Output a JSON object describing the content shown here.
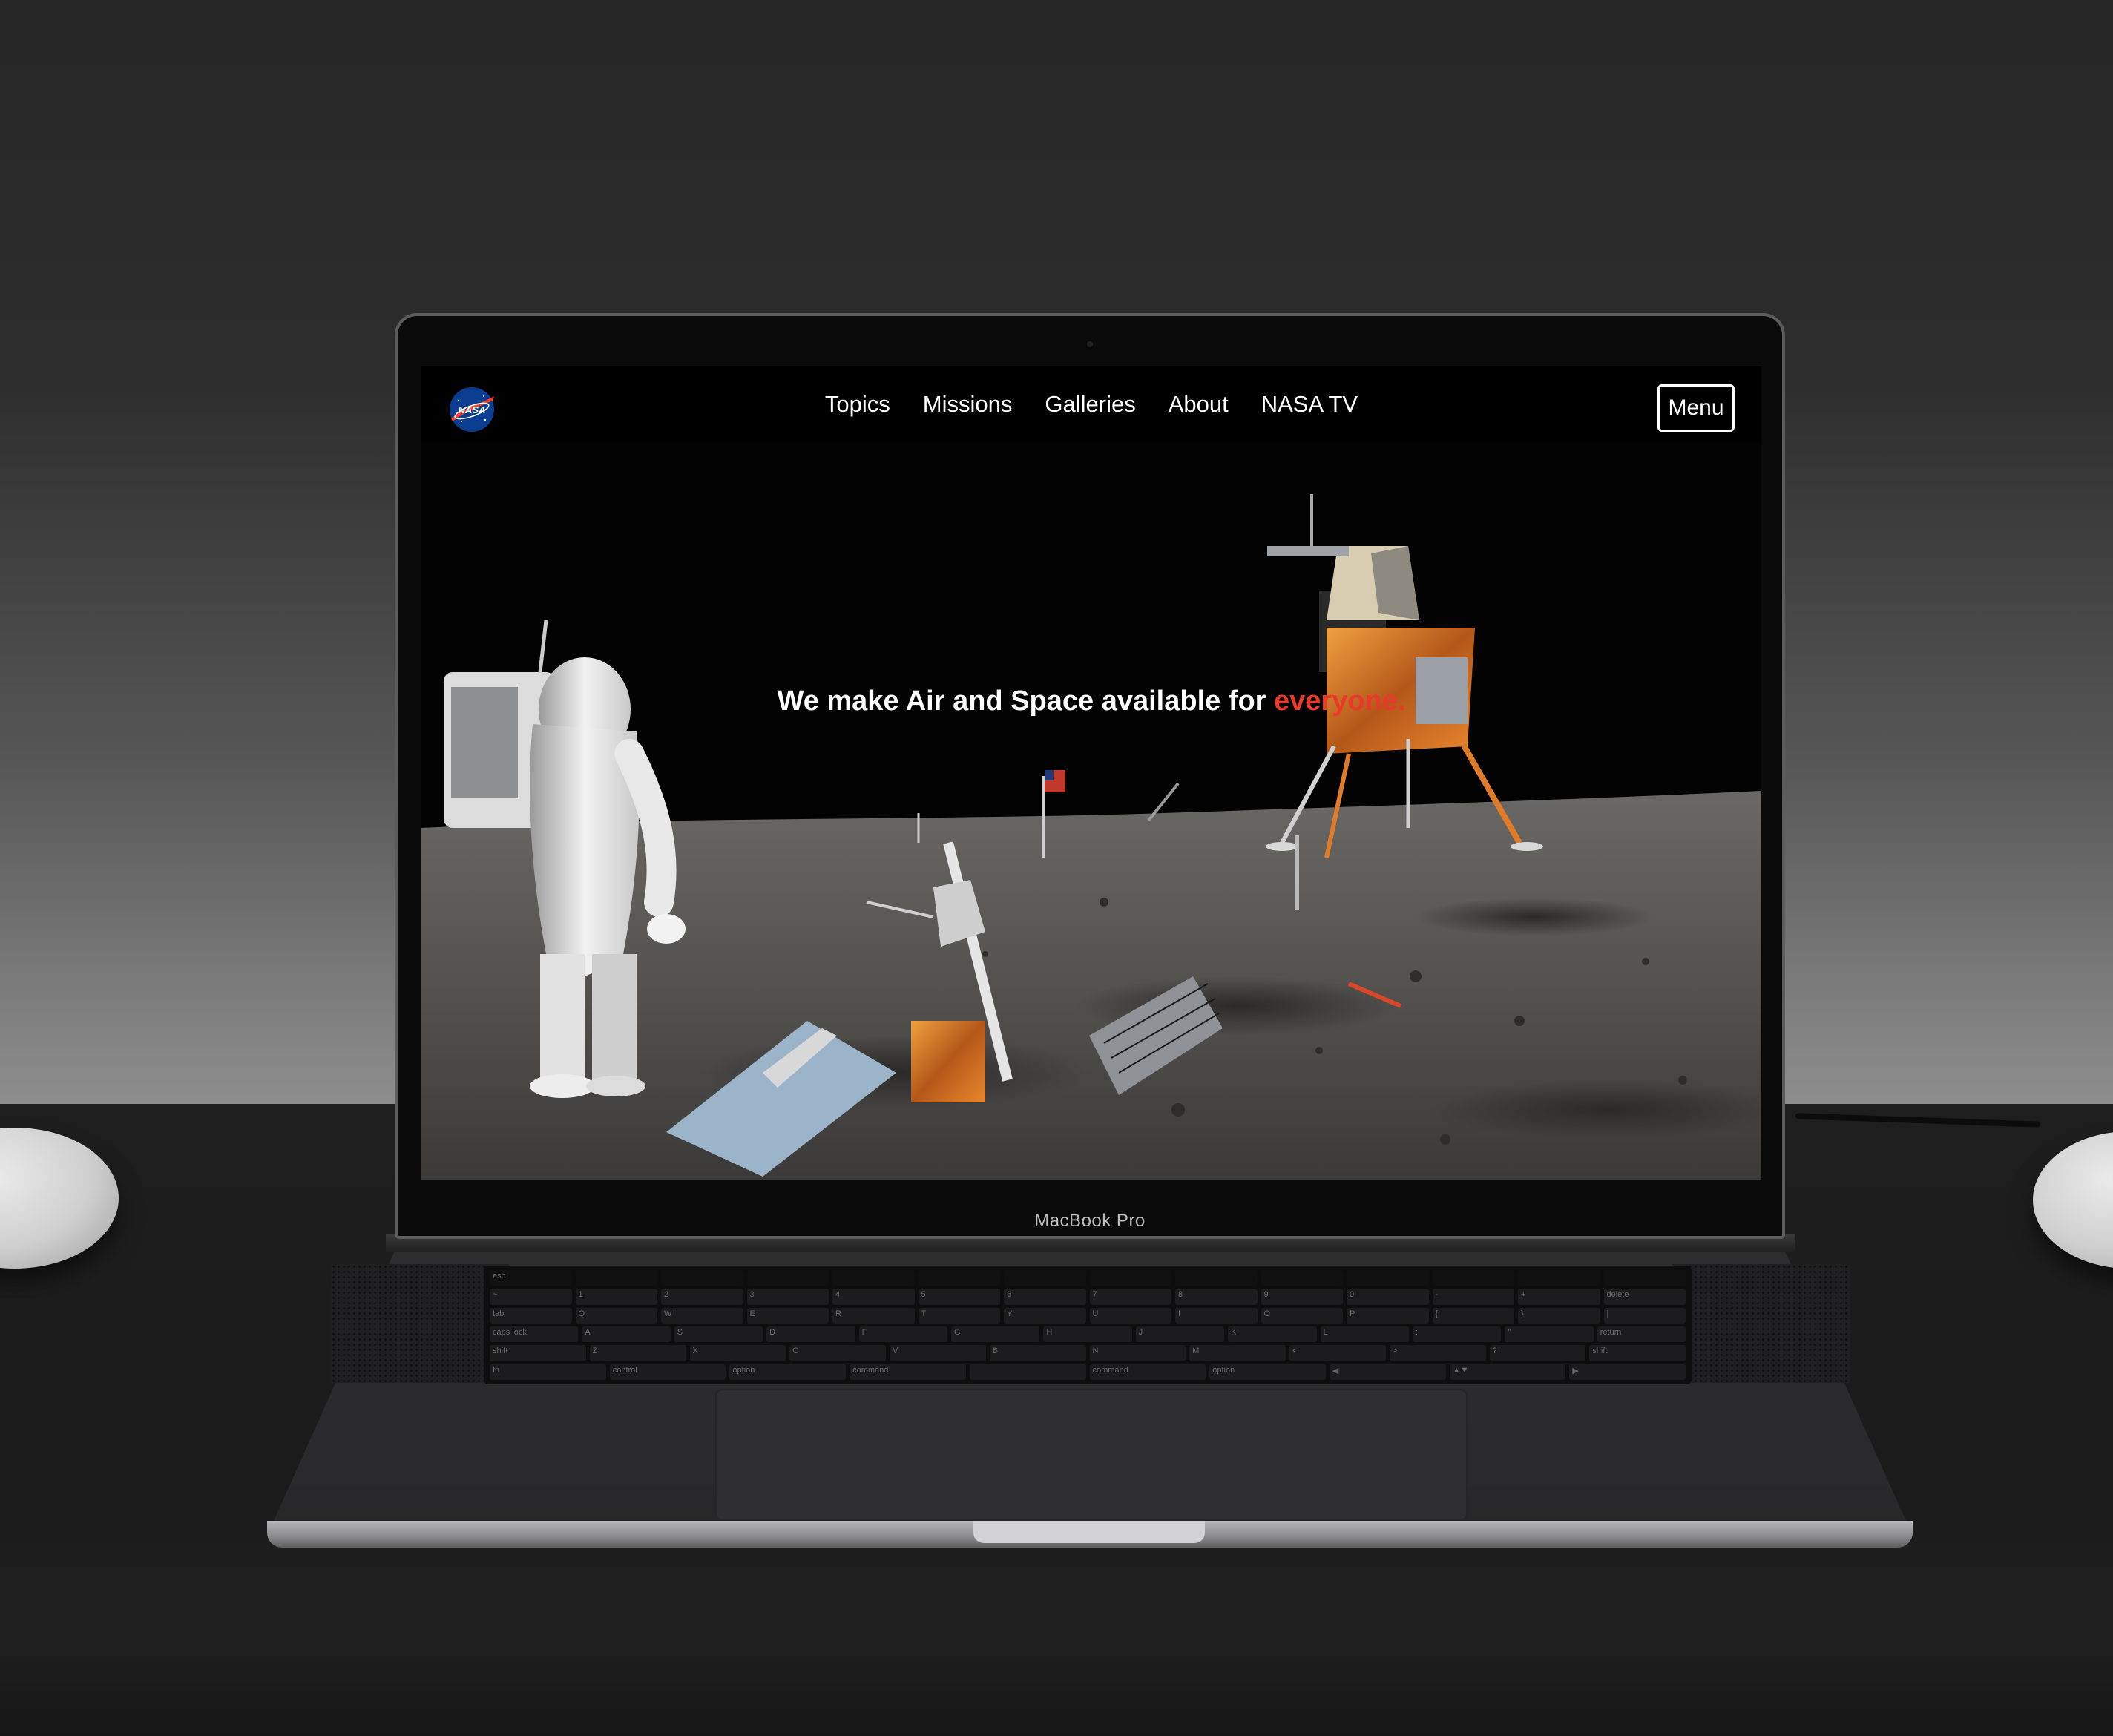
{
  "device": {
    "model_label": "MacBook Pro"
  },
  "site": {
    "logo_text": "NASA",
    "nav": {
      "items": [
        {
          "label": "Topics"
        },
        {
          "label": "Missions"
        },
        {
          "label": "Galleries"
        },
        {
          "label": "About"
        },
        {
          "label": "NASA TV"
        }
      ],
      "menu_label": "Menu"
    },
    "hero": {
      "headline_prefix": "We make Air and Space available for ",
      "headline_accent": "everyone",
      "headline_suffix": ".",
      "accent_color": "#e8392a"
    }
  },
  "keyboard": {
    "rows": [
      [
        "esc",
        "",
        "",
        "",
        "",
        "",
        "",
        "",
        "",
        "",
        "",
        "",
        "",
        ""
      ],
      [
        "~",
        "1",
        "2",
        "3",
        "4",
        "5",
        "6",
        "7",
        "8",
        "9",
        "0",
        "-",
        "+",
        "delete"
      ],
      [
        "tab",
        "Q",
        "W",
        "E",
        "R",
        "T",
        "Y",
        "U",
        "I",
        "O",
        "P",
        "{",
        "}",
        "|"
      ],
      [
        "caps lock",
        "A",
        "S",
        "D",
        "F",
        "G",
        "H",
        "J",
        "K",
        "L",
        ":",
        "\"",
        "return"
      ],
      [
        "shift",
        "Z",
        "X",
        "C",
        "V",
        "B",
        "N",
        "M",
        "<",
        ">",
        "?",
        "shift"
      ],
      [
        "fn",
        "control",
        "option",
        "command",
        "",
        "command",
        "option",
        "◀",
        "▲▼",
        "▶"
      ]
    ]
  }
}
